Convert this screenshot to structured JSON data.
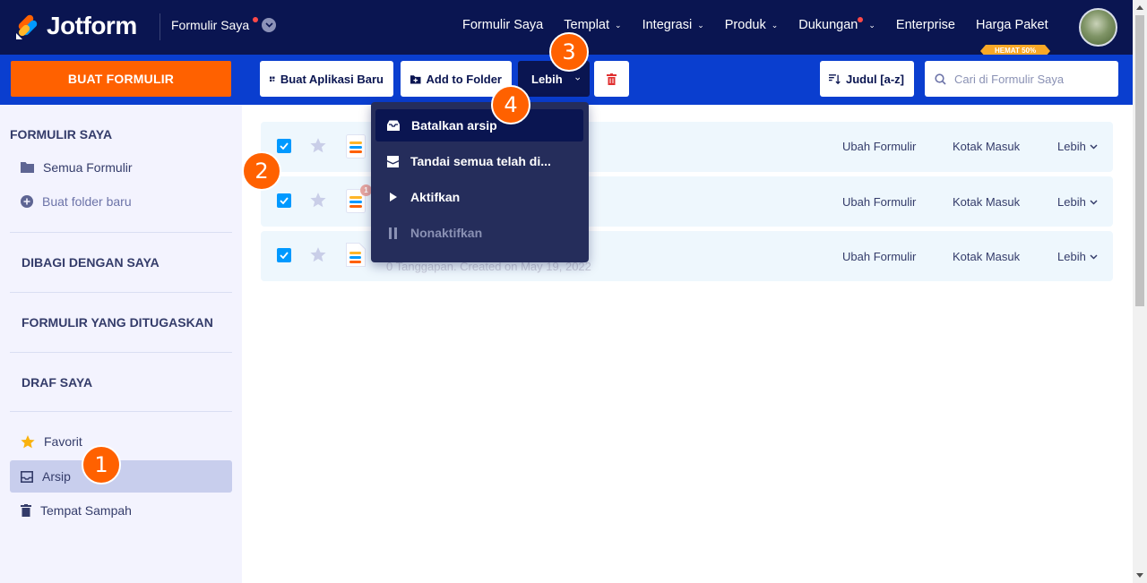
{
  "brand": {
    "name": "Jotform",
    "accent": "#ff6100",
    "nav_bg": "#0a1551",
    "toolbar_bg": "#0a3ecf"
  },
  "header": {
    "switcher_label": "Formulir Saya",
    "nav": [
      {
        "label": "Formulir Saya",
        "dropdown": false,
        "dot": false
      },
      {
        "label": "Templat",
        "dropdown": true,
        "dot": false
      },
      {
        "label": "Integrasi",
        "dropdown": true,
        "dot": false
      },
      {
        "label": "Produk",
        "dropdown": true,
        "dot": false
      },
      {
        "label": "Dukungan",
        "dropdown": true,
        "dot": true
      },
      {
        "label": "Enterprise",
        "dropdown": false,
        "dot": false
      },
      {
        "label": "Harga Paket",
        "dropdown": false,
        "dot": false
      }
    ],
    "pricing_badge": "HEMAT 50%"
  },
  "toolbar": {
    "create_label": "BUAT FORMULIR",
    "new_app_label": "Buat Aplikasi Baru",
    "add_folder_label": "Add to Folder",
    "more_label": "Lebih",
    "sort_label": "Judul [a-z]",
    "search_placeholder": "Cari di Formulir Saya"
  },
  "sidebar": {
    "my_forms_heading": "FORMULIR SAYA",
    "all_forms": "Semua Formulir",
    "new_folder": "Buat folder baru",
    "shared": "DIBAGI DENGAN SAYA",
    "assigned": "FORMULIR YANG DITUGASKAN",
    "drafts": "DRAF SAYA",
    "favorites": "Favorit",
    "archive": "Arsip",
    "trash": "Tempat Sampah"
  },
  "rows": [
    {
      "meta": "",
      "badge": "",
      "edit": "Ubah Formulir",
      "inbox": "Kotak Masuk",
      "more": "Lebih"
    },
    {
      "meta": "",
      "badge": "1",
      "edit": "Ubah Formulir",
      "inbox": "Kotak Masuk",
      "more": "Lebih"
    },
    {
      "meta": "0 Tanggapan. Created on May 19, 2022",
      "badge": "",
      "edit": "Ubah Formulir",
      "inbox": "Kotak Masuk",
      "more": "Lebih"
    }
  ],
  "dropdown": {
    "items": [
      {
        "label": "Batalkan arsip",
        "icon": "unarchive-icon"
      },
      {
        "label": "Tandai semua telah di...",
        "icon": "mark-read-icon"
      },
      {
        "label": "Aktifkan",
        "icon": "play-icon"
      },
      {
        "label": "Nonaktifkan",
        "icon": "pause-icon"
      }
    ]
  },
  "steps": {
    "s1": "1",
    "s2": "2",
    "s3": "3",
    "s4": "4"
  }
}
